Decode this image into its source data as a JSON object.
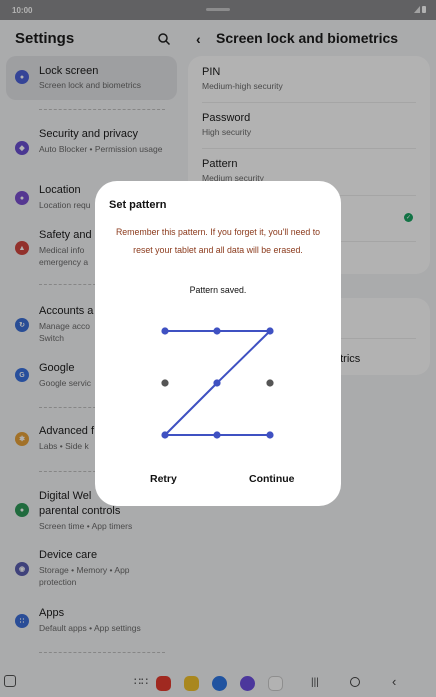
{
  "status_bar": {
    "time": "10:00"
  },
  "settings": {
    "title": "Settings",
    "items": [
      {
        "title": "Lock screen",
        "subtitle": "Screen lock and biometrics",
        "color": "#4c62d8"
      },
      {
        "title": "Security and privacy",
        "subtitle": "Auto Blocker • Permission usage",
        "color": "#6a4fd1"
      },
      {
        "title": "Location",
        "subtitle": "Location requ",
        "color": "#7a4fd0"
      },
      {
        "title": "Safety and",
        "subtitle": "Medical info emergency a",
        "color": "#d2473f"
      },
      {
        "title": "Accounts a",
        "subtitle": "Manage acco Switch",
        "color": "#3b6fd6"
      },
      {
        "title": "Google",
        "subtitle": "Google servic",
        "color": "#3a72e0"
      },
      {
        "title": "Advanced f",
        "subtitle": "Labs • Side k",
        "color": "#e8a23a"
      },
      {
        "title": "Digital Wel parental controls",
        "subtitle": "Screen time • App timers",
        "color": "#2f9a5a"
      },
      {
        "title": "Device care",
        "subtitle": "Storage • Memory • App protection",
        "color": "#5b5fb0"
      },
      {
        "title": "Apps",
        "subtitle": "Default apps • App settings",
        "color": "#3d6fd8"
      }
    ]
  },
  "lock_panel": {
    "title": "Screen lock and biometrics",
    "options": [
      {
        "title": "PIN",
        "subtitle": "Medium-high security"
      },
      {
        "title": "Password",
        "subtitle": "High security"
      },
      {
        "title": "Pattern",
        "subtitle": "Medium security"
      }
    ],
    "second_card_text": "etrics",
    "check_color": "#1aa564"
  },
  "dialog": {
    "title": "Set pattern",
    "warning": "Remember this pattern. If you forget it, you'll need to reset your tablet and all data will be erased.",
    "status": "Pattern saved.",
    "retry_label": "Retry",
    "continue_label": "Continue",
    "pattern_color": "#3f51c2",
    "inactive_dot_color": "#555555",
    "pattern_sequence": [
      1,
      2,
      3,
      5,
      7,
      8,
      9
    ]
  }
}
